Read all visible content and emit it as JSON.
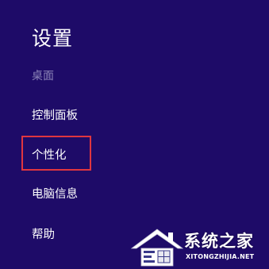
{
  "colors": {
    "background": "#1e0b68",
    "text": "#ffffff",
    "subtitle": "#8c84b8",
    "highlight": "#e0363f"
  },
  "settings": {
    "title": "设置",
    "subtitle": "桌面",
    "items": [
      {
        "label": "控制面板"
      },
      {
        "label": "个性化"
      },
      {
        "label": "电脑信息"
      },
      {
        "label": "帮助"
      }
    ]
  },
  "watermark": {
    "name": "系统之家",
    "url": "XITONGZHIJIA.NET",
    "icon": "house-logo-icon"
  }
}
